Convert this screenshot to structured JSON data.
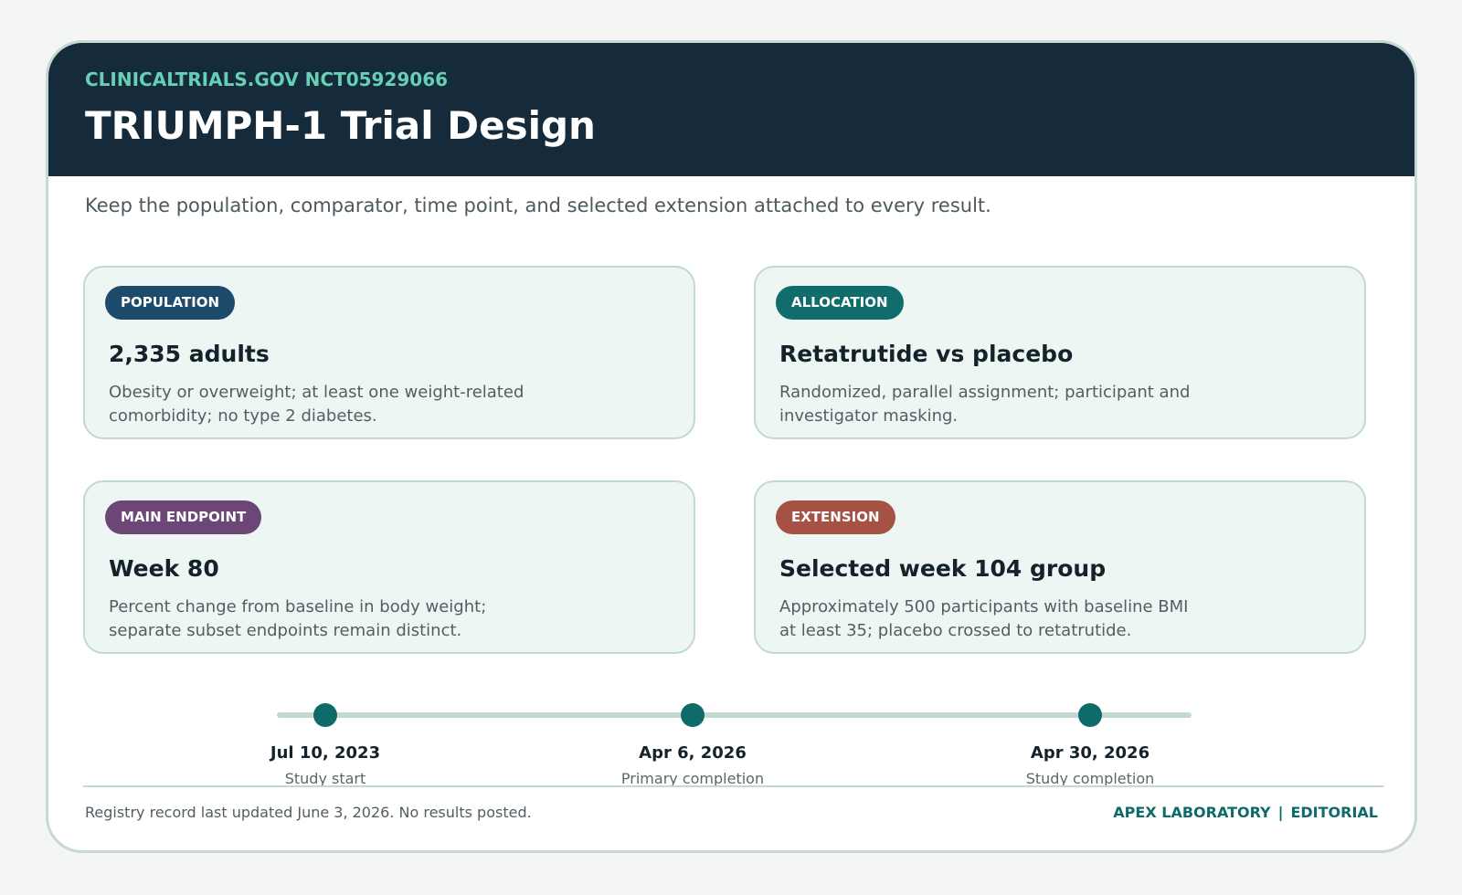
{
  "header": {
    "eyebrow": "CLINICALTRIALS.GOV NCT05929066",
    "title": "TRIUMPH-1 Trial Design"
  },
  "subtitle": "Keep the population, comparator, time point, and selected extension attached to every result.",
  "cards": [
    {
      "badge": "POPULATION",
      "badge_color": "#1e4a6b",
      "heading": "2,335 adults",
      "body": "Obesity or overweight; at least one weight-related comorbidity; no type 2 diabetes."
    },
    {
      "badge": "ALLOCATION",
      "badge_color": "#116d6b",
      "heading": "Retatrutide vs placebo",
      "body": "Randomized, parallel assignment; participant and investigator masking."
    },
    {
      "badge": "MAIN ENDPOINT",
      "badge_color": "#6b4677",
      "heading": "Week 80",
      "body": "Percent change from baseline in body weight; separate subset endpoints remain distinct."
    },
    {
      "badge": "EXTENSION",
      "badge_color": "#a55144",
      "heading": "Selected week 104 group",
      "body": "Approximately 500 participants with baseline BMI at least 35; placebo crossed to retatrutide."
    }
  ],
  "timeline": [
    {
      "date": "Jul 10, 2023",
      "label": "Study start"
    },
    {
      "date": "Apr 6, 2026",
      "label": "Primary completion"
    },
    {
      "date": "Apr 30, 2026",
      "label": "Study completion"
    }
  ],
  "footer": {
    "note": "Registry record last updated June 3, 2026. No results posted.",
    "brand": "APEX LABORATORY",
    "separator": "|",
    "section": "EDITORIAL"
  }
}
